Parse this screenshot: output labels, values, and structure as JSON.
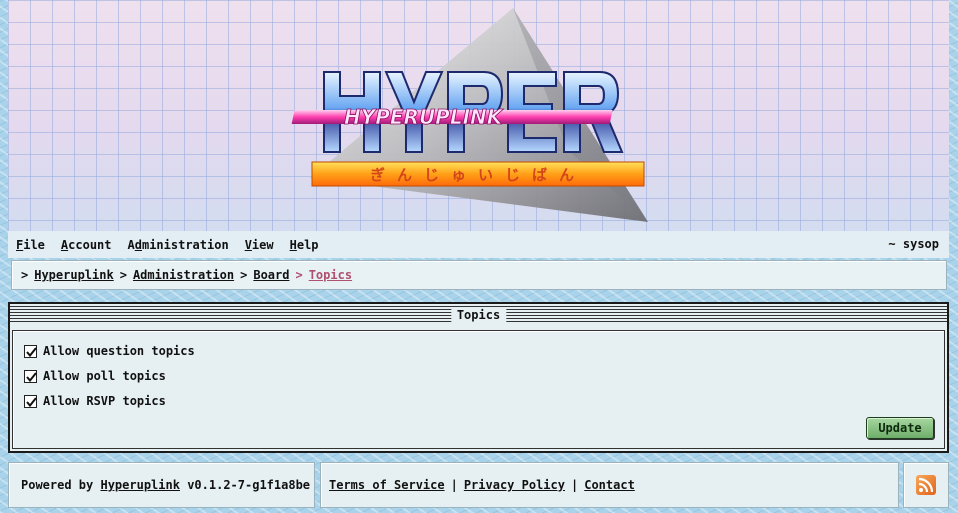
{
  "banner": {
    "logo_text": "HYPERUPLINK",
    "logo_subtitle": "ぎんじゅいじばん"
  },
  "menubar": {
    "items": [
      {
        "first": "F",
        "rest": "ile"
      },
      {
        "first": "A",
        "rest": "ccount"
      },
      {
        "first": "Ad",
        "rest": "ministration",
        "pre": "",
        "underline_index": 1
      },
      {
        "first": "V",
        "rest": "iew"
      },
      {
        "first": "H",
        "rest": "elp"
      }
    ],
    "user": "~ sysop"
  },
  "breadcrumb": {
    "sep": ">",
    "items": [
      "Hyperuplink",
      "Administration",
      "Board"
    ],
    "current": "Topics"
  },
  "panel": {
    "title": "Topics",
    "options": [
      {
        "label": "Allow question topics",
        "checked": true
      },
      {
        "label": "Allow poll topics",
        "checked": true
      },
      {
        "label": "Allow RSVP topics",
        "checked": true
      }
    ],
    "update_label": "Update"
  },
  "footer": {
    "powered_prefix": "Powered by",
    "powered_link": "Hyperuplink",
    "version": "v0.1.2-7-g1f1a8be",
    "links": [
      "Terms of Service",
      "Privacy Policy",
      "Contact"
    ],
    "sep": "|"
  },
  "icons": {
    "rss": "rss-feed-icon",
    "checkbox": "checkmark-icon"
  },
  "colors": {
    "accent_current": "#b0506f",
    "update_button": "#8cc486",
    "rss": "#e8792c"
  }
}
